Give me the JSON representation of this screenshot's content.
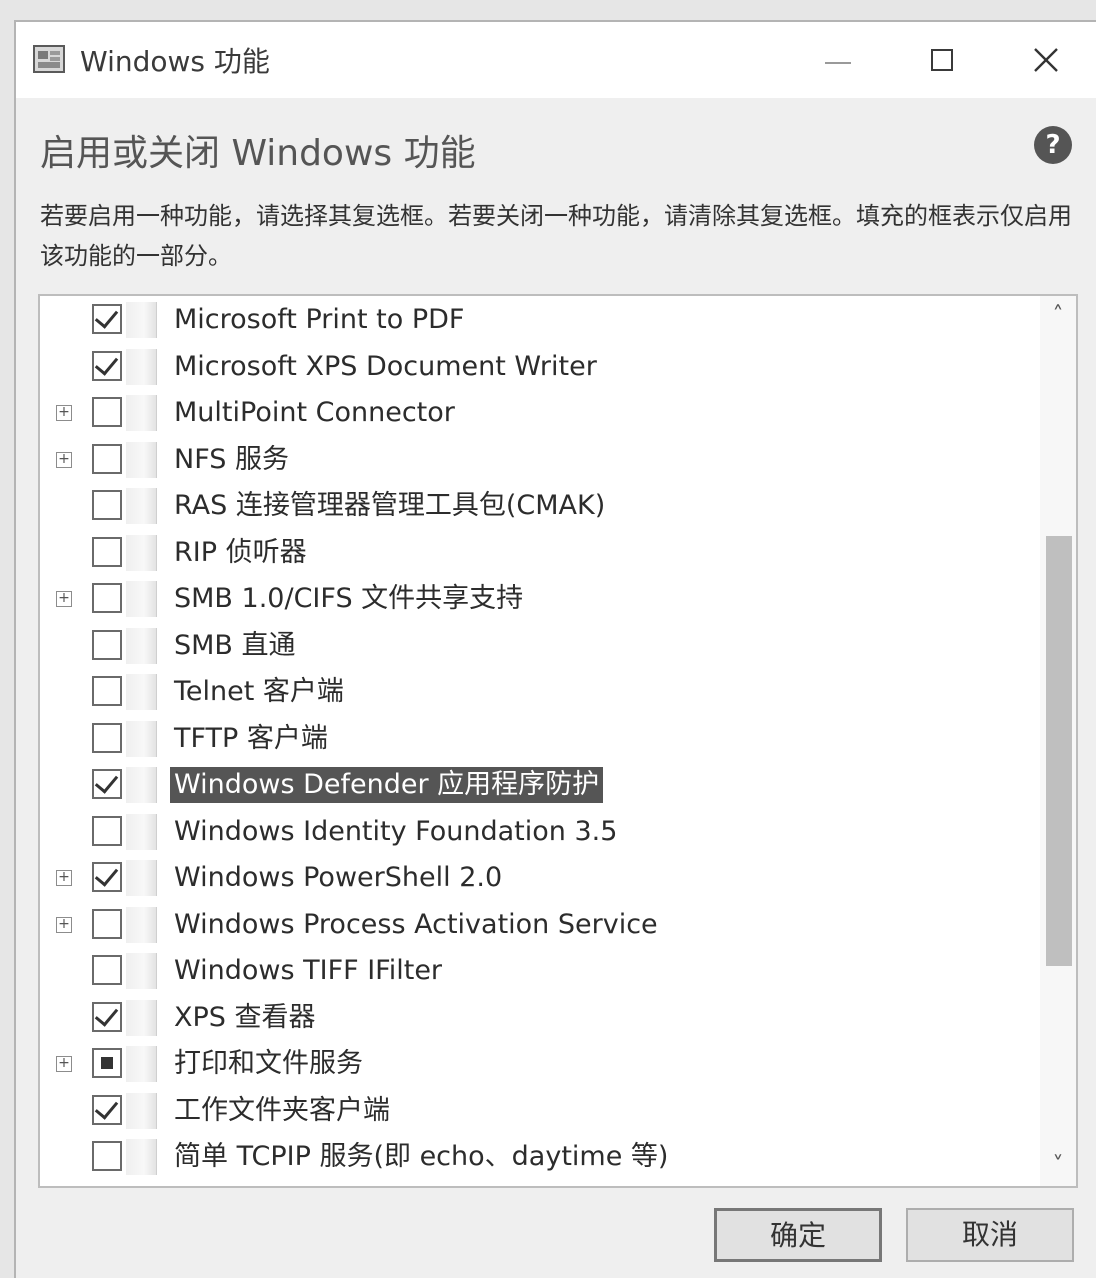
{
  "window": {
    "title": "Windows 功能",
    "heading": "启用或关闭 Windows 功能",
    "description": "若要启用一种功能，请选择其复选框。若要关闭一种功能，请清除其复选框。填充的框表示仅启用该功能的一部分。",
    "help_glyph": "?",
    "close_glyph": "✕"
  },
  "features": [
    {
      "label": "Microsoft Print to PDF",
      "state": "checked",
      "expandable": false,
      "selected": false
    },
    {
      "label": "Microsoft XPS Document Writer",
      "state": "checked",
      "expandable": false,
      "selected": false
    },
    {
      "label": "MultiPoint Connector",
      "state": "unchecked",
      "expandable": true,
      "selected": false
    },
    {
      "label": "NFS 服务",
      "state": "unchecked",
      "expandable": true,
      "selected": false
    },
    {
      "label": "RAS 连接管理器管理工具包(CMAK)",
      "state": "unchecked",
      "expandable": false,
      "selected": false
    },
    {
      "label": "RIP 侦听器",
      "state": "unchecked",
      "expandable": false,
      "selected": false
    },
    {
      "label": "SMB 1.0/CIFS 文件共享支持",
      "state": "unchecked",
      "expandable": true,
      "selected": false
    },
    {
      "label": "SMB 直通",
      "state": "unchecked",
      "expandable": false,
      "selected": false
    },
    {
      "label": "Telnet 客户端",
      "state": "unchecked",
      "expandable": false,
      "selected": false
    },
    {
      "label": "TFTP 客户端",
      "state": "unchecked",
      "expandable": false,
      "selected": false
    },
    {
      "label": "Windows Defender 应用程序防护",
      "state": "checked",
      "expandable": false,
      "selected": true
    },
    {
      "label": "Windows Identity Foundation 3.5",
      "state": "unchecked",
      "expandable": false,
      "selected": false
    },
    {
      "label": "Windows PowerShell 2.0",
      "state": "checked",
      "expandable": true,
      "selected": false
    },
    {
      "label": "Windows Process Activation Service",
      "state": "unchecked",
      "expandable": true,
      "selected": false
    },
    {
      "label": "Windows TIFF IFilter",
      "state": "unchecked",
      "expandable": false,
      "selected": false
    },
    {
      "label": "XPS 查看器",
      "state": "checked",
      "expandable": false,
      "selected": false
    },
    {
      "label": "打印和文件服务",
      "state": "partial",
      "expandable": true,
      "selected": false
    },
    {
      "label": "工作文件夹客户端",
      "state": "checked",
      "expandable": false,
      "selected": false
    },
    {
      "label": "简单 TCPIP 服务(即 echo、daytime 等)",
      "state": "unchecked",
      "expandable": false,
      "selected": false
    }
  ],
  "buttons": {
    "ok_label": "确定",
    "cancel_label": "取消"
  },
  "icons": {
    "expander_glyph": "+",
    "scroll_up_glyph": "˄",
    "scroll_down_glyph": "˅"
  }
}
